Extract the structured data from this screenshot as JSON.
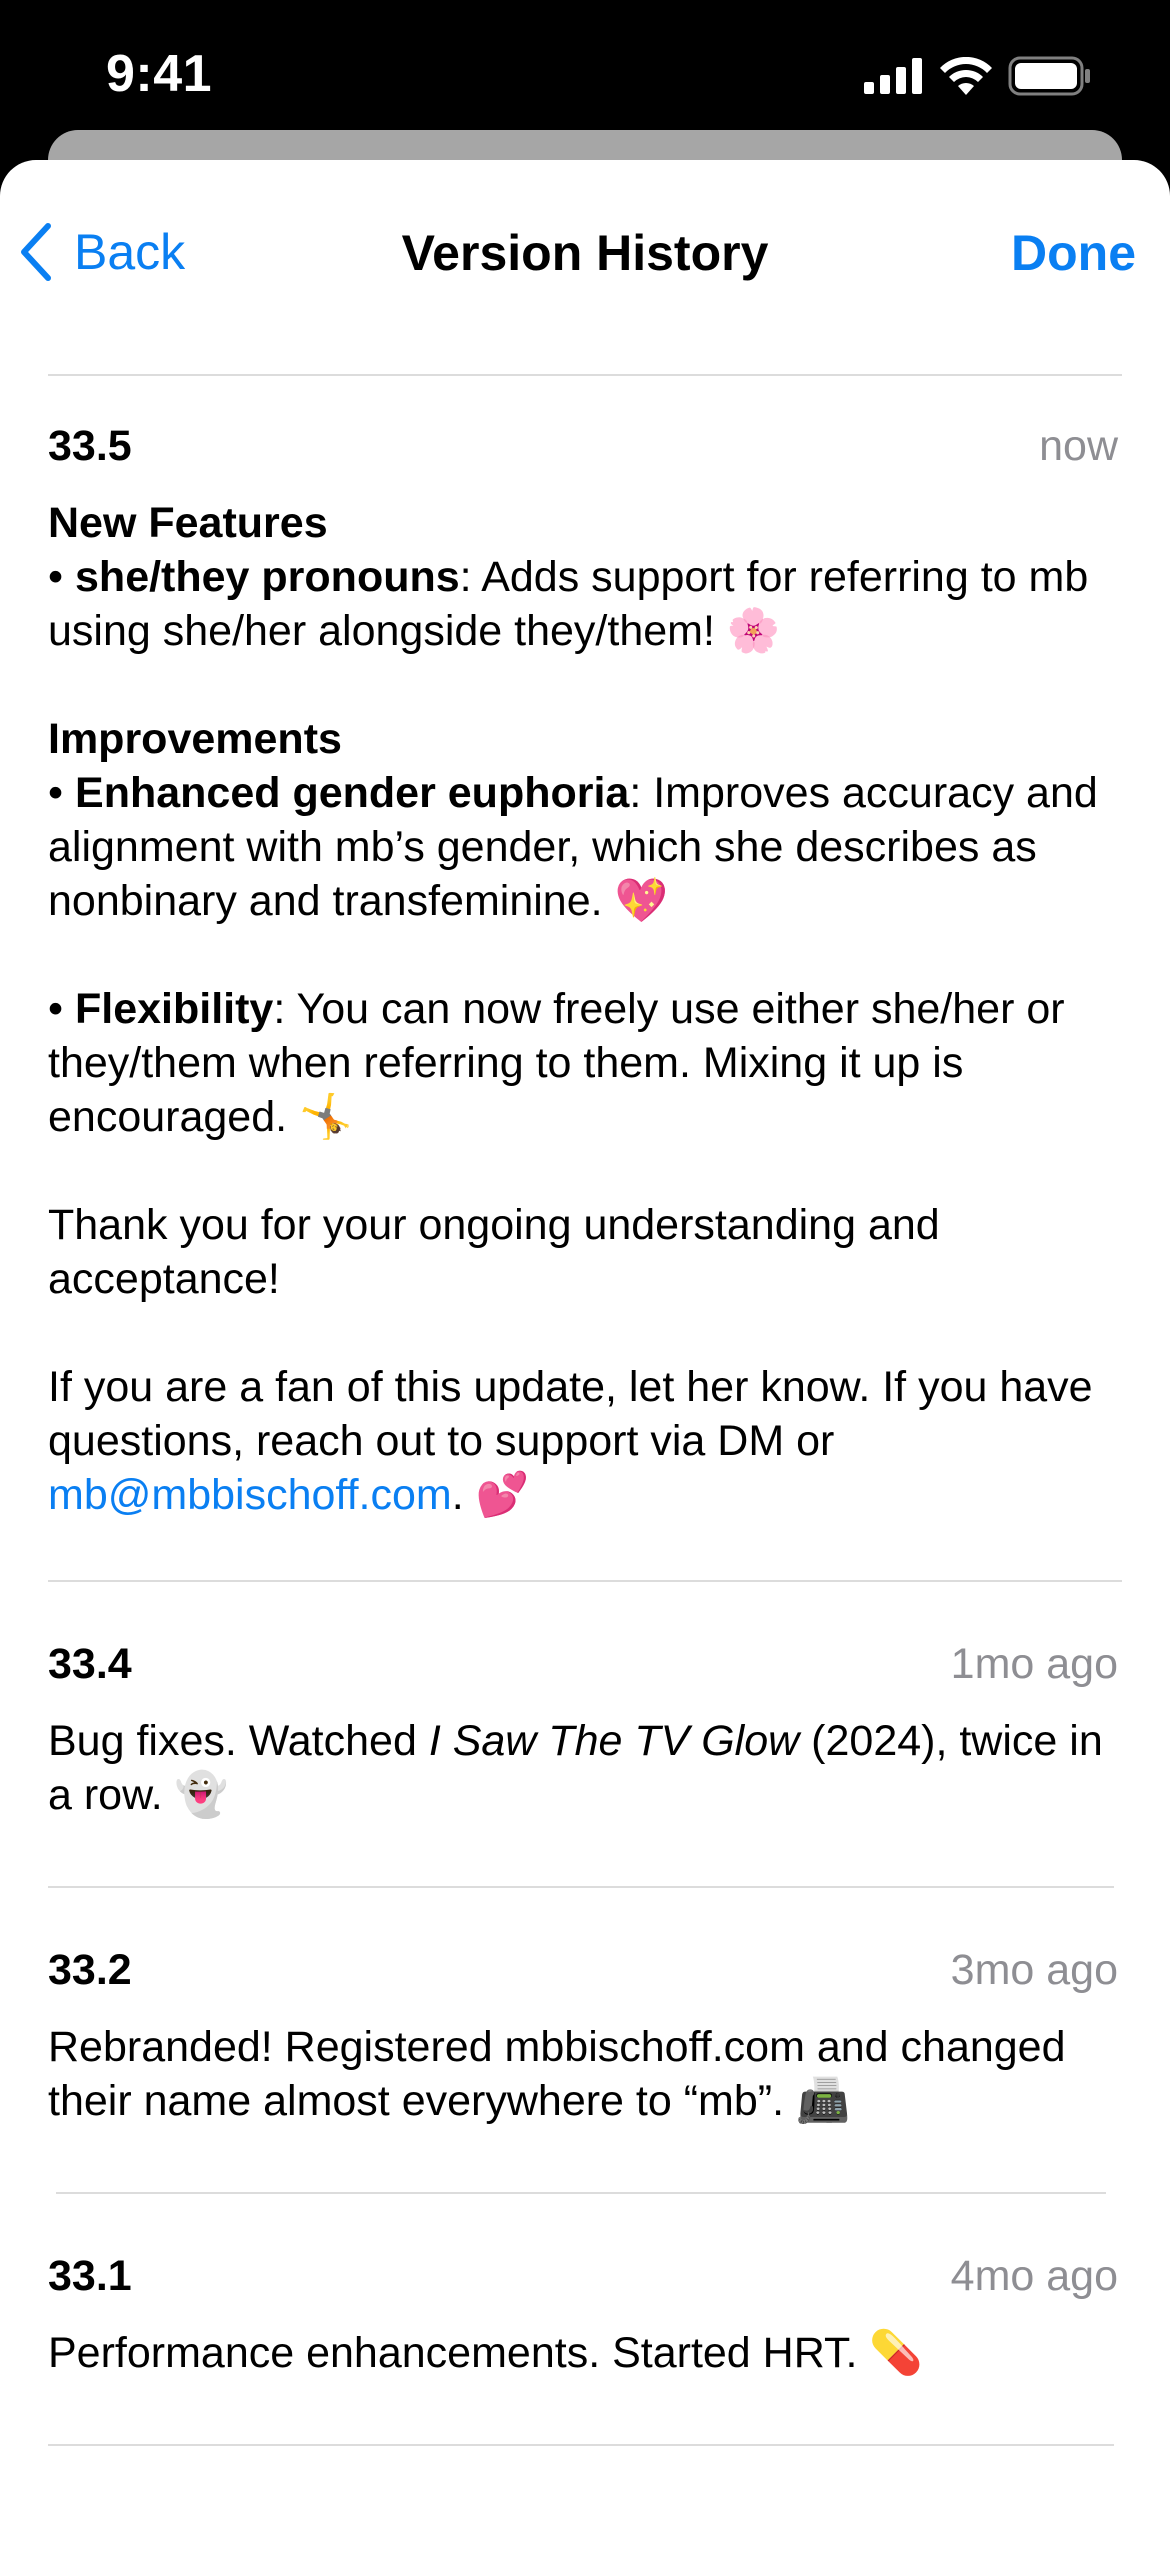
{
  "status_bar": {
    "time": "9:41",
    "icons": [
      "cellular-signal-icon",
      "wifi-icon",
      "battery-icon"
    ]
  },
  "nav": {
    "back_label": "Back",
    "title": "Version History",
    "done_label": "Done"
  },
  "colors": {
    "accent": "#0a7ff2",
    "secondary_text": "#8e8e93",
    "divider": "#dcdcdc"
  },
  "entries": [
    {
      "version": "33.5",
      "time": "now",
      "new_features_heading": "New Features",
      "pronouns_bold": "she/they pronouns",
      "pronouns_text": ": Adds support for referring to mb using she/her alongside they/them!",
      "pronouns_emoji": "🌸",
      "improvements_heading": "Improvements",
      "euphoria_bold": "Enhanced gender euphoria",
      "euphoria_text": ": Improves accuracy and alignment with mb’s gender, which she describes as nonbinary and transfeminine.",
      "euphoria_emoji": "💖",
      "flex_bold": "Flexibility",
      "flex_text": ": You can now freely use either she/her or they/them when referring to them. Mixing it up is encouraged.",
      "flex_emoji": "🤸",
      "thanks": "Thank you for your ongoing understanding and acceptance!",
      "fan_text": "If you are a fan of this update, let her know. If you have questions, reach out to support via DM or",
      "email": "mb@mbbischoff.com",
      "fan_end": ".",
      "fan_emoji": "💕"
    },
    {
      "version": "33.4",
      "time": "1mo ago",
      "text_before": "Bug fixes. Watched",
      "italic": "I Saw The TV Glow",
      "text_after": "(2024), twice in a row.",
      "emoji": "👻"
    },
    {
      "version": "33.2",
      "time": "3mo ago",
      "text": "Rebranded! Registered mbbischoff.com and changed their name almost everywhere to “mb”.",
      "emoji": "📠"
    },
    {
      "version": "33.1",
      "time": "4mo ago",
      "text": "Performance enhancements. Started HRT.",
      "emoji": "💊"
    }
  ]
}
